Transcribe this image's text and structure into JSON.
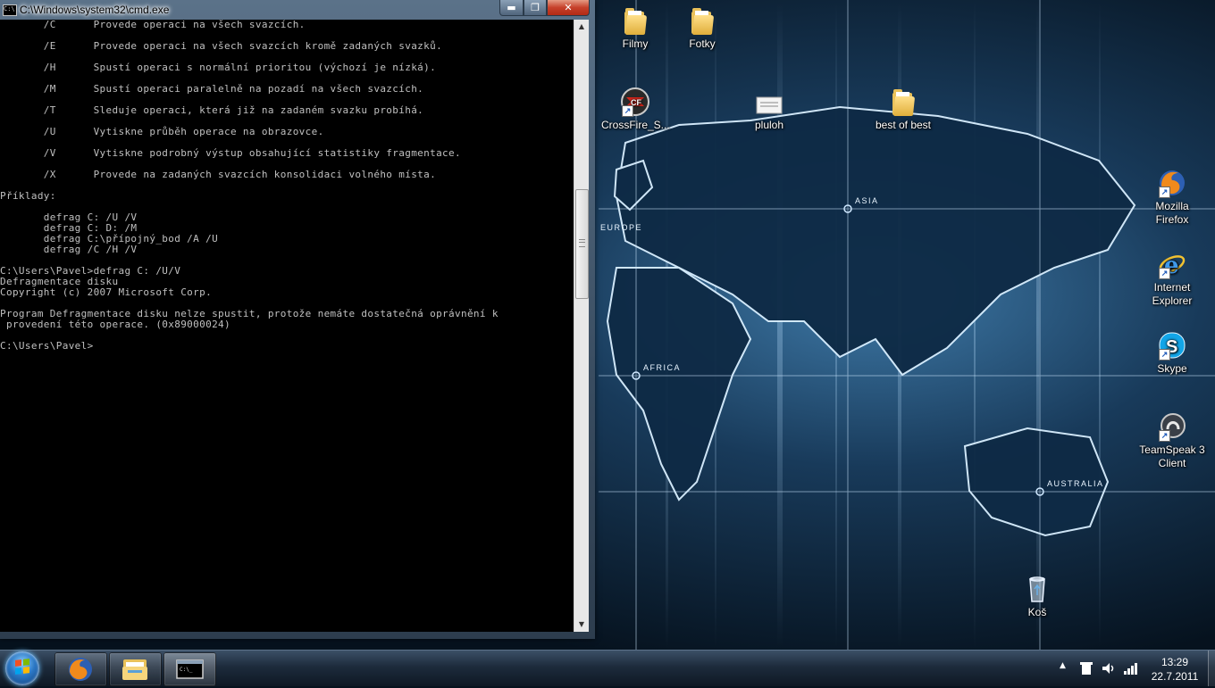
{
  "cmd_window": {
    "title": "C:\\Windows\\system32\\cmd.exe",
    "titlebar_icon_text": "C:\\",
    "buttons": {
      "minimize": "▬",
      "maximize": "❐",
      "close": "✕"
    },
    "console_text": "       /C      Provede operaci na všech svazcích.\n\n       /E      Provede operaci na všech svazcích kromě zadaných svazků.\n\n       /H      Spustí operaci s normální prioritou (výchozí je nízká).\n\n       /M      Spustí operaci paralelně na pozadí na všech svazcích.\n\n       /T      Sleduje operaci, která již na zadaném svazku probíhá.\n\n       /U      Vytiskne průběh operace na obrazovce.\n\n       /V      Vytiskne podrobný výstup obsahující statistiky fragmentace.\n\n       /X      Provede na zadaných svazcích konsolidaci volného místa.\n\nPříklady:\n\n       defrag C: /U /V\n       defrag C: D: /M\n       defrag C:\\přípojný_bod /A /U\n       defrag /C /H /V\n\nC:\\Users\\Pavel>defrag C: /U/V\nDefragmentace disku\nCopyright (c) 2007 Microsoft Corp.\n\nProgram Defragmentace disku nelze spustit, protože nemáte dostatečná oprávnění k\n provedení této operace. (0x89000024)\n\nC:\\Users\\Pavel>",
    "scroll_up": "▲",
    "scroll_down": "▼"
  },
  "desktop": {
    "icons": [
      {
        "label": "Filmy",
        "icon": "folder-icon"
      },
      {
        "label": "Fotky",
        "icon": "folder-icon"
      },
      {
        "label": "CrossFire_S...",
        "icon": "crossfire-icon"
      },
      {
        "label": "pluloh",
        "icon": "text-file-icon"
      },
      {
        "label": "best of best",
        "icon": "folder-icon"
      },
      {
        "label": "Mozilla\nFirefox",
        "icon": "firefox-icon"
      },
      {
        "label": "Internet\nExplorer",
        "icon": "internet-explorer-icon"
      },
      {
        "label": "Skype",
        "icon": "skype-icon"
      },
      {
        "label": "TeamSpeak 3\nClient",
        "icon": "teamspeak-icon"
      },
      {
        "label": "Koš",
        "icon": "recycle-bin-icon"
      }
    ],
    "wallpaper_labels": {
      "europe": "EUROPE",
      "asia": "ASIA",
      "africa": "AFRICA",
      "australia": "AUSTRALIA"
    }
  },
  "taskbar": {
    "pinned": [
      {
        "name": "Firefox",
        "icon": "firefox-icon"
      },
      {
        "name": "Windows Explorer",
        "icon": "folder-icon"
      },
      {
        "name": "Command Prompt",
        "icon": "cmd-icon",
        "active": true
      }
    ],
    "tray": {
      "show_hidden": "▲",
      "time": "13:29",
      "date": "22.7.2011"
    }
  },
  "colors": {
    "console_bg": "#000000",
    "console_fg": "#c0c0c0",
    "close_button": "#c6402a",
    "wallpaper_glow": "#9fd0ff"
  }
}
